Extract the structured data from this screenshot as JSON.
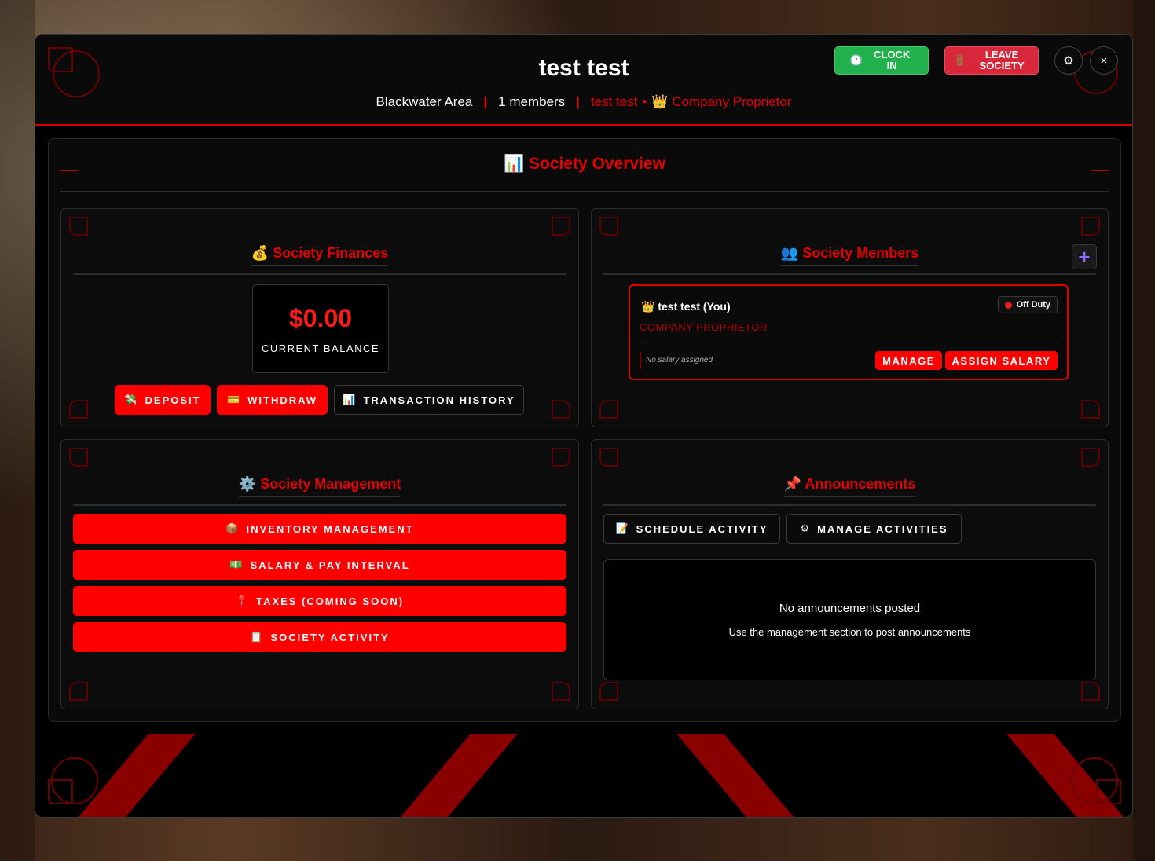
{
  "header": {
    "title": "test test",
    "area": "Blackwater Area",
    "members": "1 members",
    "user": "test test",
    "role": "Company Proprietor",
    "clock_in": "CLOCK IN",
    "leave": "LEAVE SOCIETY",
    "settings_icon": "⚙",
    "close_icon": "×"
  },
  "overview": {
    "title": "Society Overview",
    "icon": "📊"
  },
  "finances": {
    "title": "Society Finances",
    "icon": "💰",
    "balance": "$0.00",
    "balance_label": "CURRENT BALANCE",
    "deposit": "DEPOSIT",
    "withdraw": "WITHDRAW",
    "history": "TRANSACTION HISTORY"
  },
  "members": {
    "title": "Society Members",
    "icon": "👥",
    "add_icon": "+",
    "list": [
      {
        "name": "test test (You)",
        "role": "COMPANY PROPRIETOR",
        "status": "Off Duty",
        "salary": "No salary assigned",
        "manage": "MANAGE",
        "assign": "ASSIGN SALARY"
      }
    ]
  },
  "management": {
    "title": "Society Management",
    "icon": "⚙️",
    "items": [
      {
        "icon": "📦",
        "label": "INVENTORY MANAGEMENT"
      },
      {
        "icon": "💵",
        "label": "SALARY & PAY INTERVAL"
      },
      {
        "icon": "📍",
        "label": "TAXES (COMING SOON)"
      },
      {
        "icon": "📋",
        "label": "SOCIETY ACTIVITY"
      }
    ]
  },
  "announcements": {
    "title": "Announcements",
    "icon": "📌",
    "schedule": "SCHEDULE ACTIVITY",
    "manage": "MANAGE ACTIVITIES",
    "empty_title": "No announcements posted",
    "empty_sub": "Use the management section to post announcements"
  },
  "colors": {
    "accent": "#ff0000",
    "clock": "#21b14d",
    "leave": "#d8263a"
  }
}
